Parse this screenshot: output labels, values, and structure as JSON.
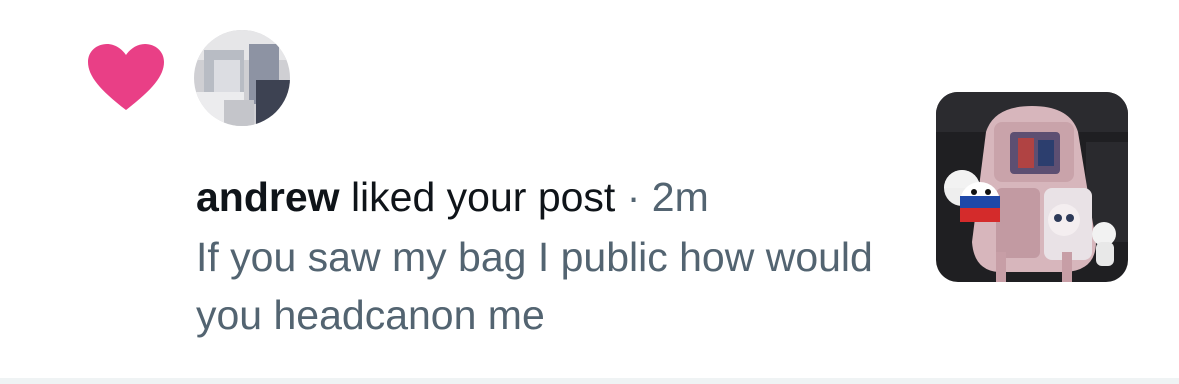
{
  "notification": {
    "type_icon": "heart-icon",
    "username": "andrew",
    "action": "liked your post",
    "separator": "·",
    "time": "2m",
    "post_text": "If you saw my bag I public how would you headcanon me"
  },
  "colors": {
    "heart": "#e0245e",
    "primary_text": "#0f1419",
    "secondary_text": "#536471",
    "divider": "#eff3f4"
  }
}
